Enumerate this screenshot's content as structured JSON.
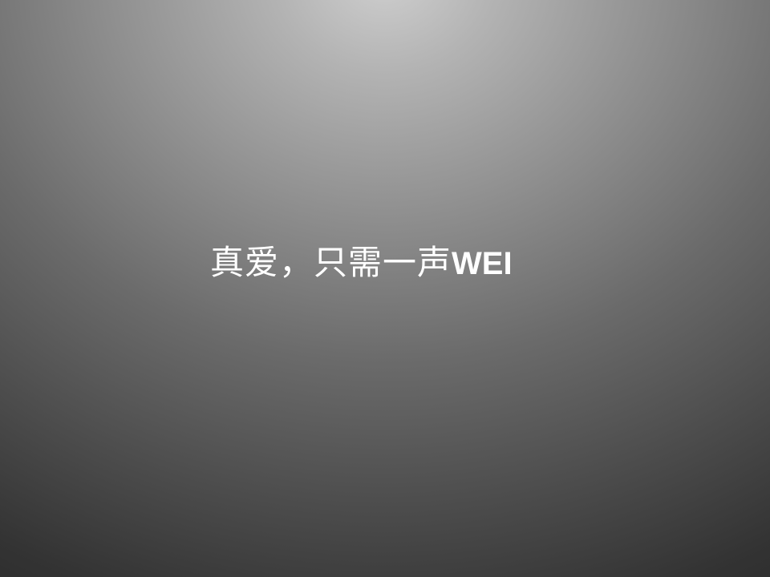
{
  "slide": {
    "title_cjk": "真爱，只需一声",
    "title_latin": "WEI"
  },
  "colors": {
    "background_center": "#cfcfcf",
    "background_edge": "#222222",
    "text": "#ffffff"
  }
}
